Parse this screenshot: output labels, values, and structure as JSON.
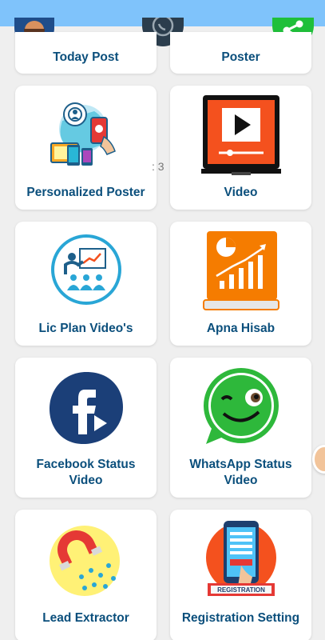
{
  "cards": {
    "today_post": "Today Post",
    "poster": "Poster",
    "personalized_poster": "Personalized Poster",
    "video": "Video",
    "lic_plan_videos": "Lic Plan Video's",
    "apna_hisab": "Apna Hisab",
    "facebook_status_video": "Facebook Status Video",
    "whatsapp_status_video": "WhatsApp Status Video",
    "lead_extractor": "Lead Extractor",
    "registration_setting": "Registration Setting"
  },
  "overlay": {
    "page_indicator": ": 3"
  },
  "icons": {
    "avatar": "user-avatar",
    "whatsapp": "whatsapp-icon",
    "share": "share-icon"
  },
  "colors": {
    "status_bar": "#7fc3fb",
    "label": "#0b4f7c",
    "background": "#efefef",
    "share_green": "#1fbf3a"
  }
}
